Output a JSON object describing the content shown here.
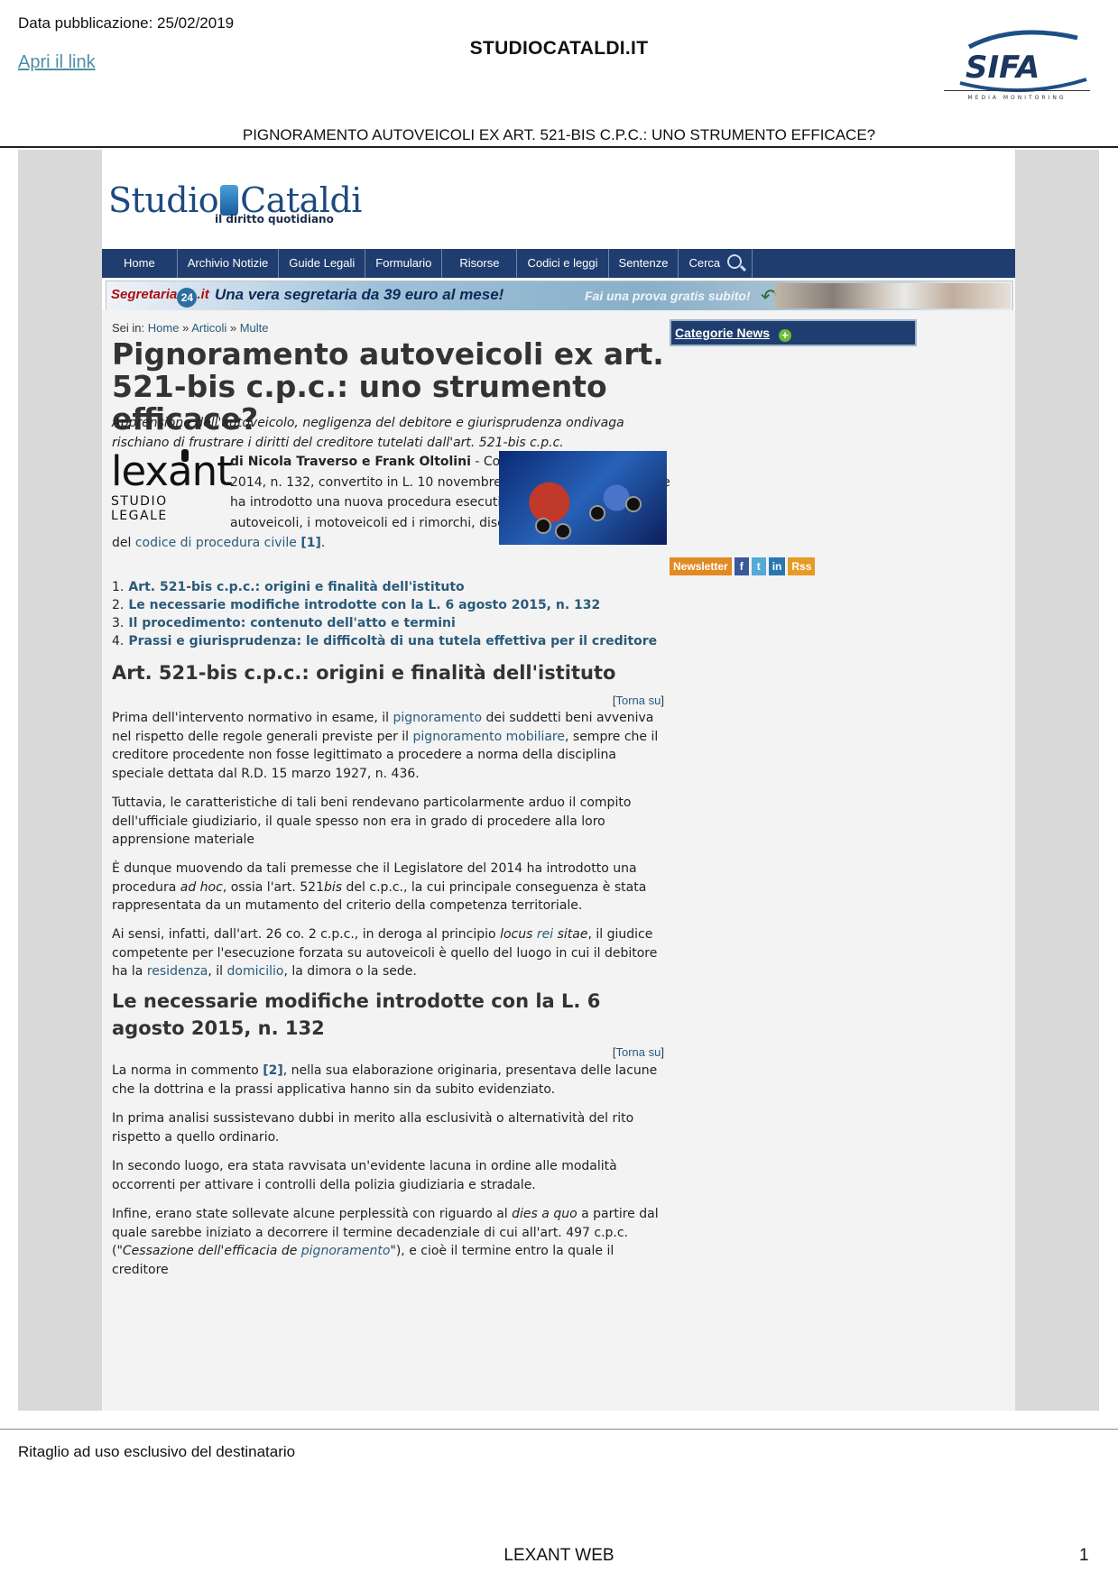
{
  "clipping": {
    "pub_date": "Data pubblicazione: 25/02/2019",
    "open_link": "Apri il link",
    "source": "STUDIOCATALDI.IT",
    "sifa_logo": "SIFA",
    "sifa_sub": "MEDIA MONITORING",
    "title": "PIGNORAMENTO AUTOVEICOLI EX ART. 521-BIS C.P.C.: UNO STRUMENTO EFFICACE?",
    "restricted": "Ritaglio ad uso esclusivo del destinatario",
    "footer_source": "LEXANT WEB",
    "page_number": "1"
  },
  "site": {
    "logo_left": "Studio",
    "logo_right": "Cataldi",
    "logo_sub": "il diritto quotidiano",
    "nav": [
      "Home",
      "Archivio Notizie",
      "Guide Legali",
      "Formulario",
      "Risorse",
      "Codici e leggi",
      "Sentenze",
      "Cerca"
    ],
    "banner": {
      "brand": "Segretaria",
      "brand_num": "24",
      "brand_tld": ".it",
      "message": "Una vera segretaria da 39 euro al mese!",
      "cta": "Fai una prova gratis subito!"
    },
    "breadcrumb": {
      "prefix": "Sei in:",
      "items": [
        "Home",
        "Articoli",
        "Multe"
      ],
      "sep": "»"
    },
    "sidebar": {
      "categories": "Categorie News",
      "social": [
        "Newsletter",
        "f",
        "t",
        "in",
        "Rss"
      ]
    }
  },
  "article": {
    "title": "Pignoramento autoveicoli ex art. 521-bis c.p.c.: uno strumento efficace?",
    "lead": "Apprensione dell'autoveicolo, negligenza del debitore e giurisprudenza ondivaga rischiano di frustrare i diritti del creditore tutelati dall'art. 521-bis c.p.c.",
    "lexant": {
      "word_a": "lex",
      "word_b": "ant",
      "sub": "STUDIO LEGALE"
    },
    "authors": "di Nicola Traverso e Frank Oltolini",
    "intro_1": " - Con il D.L. 12 settembre 2014, n. 132, convertito in L. 10 novembre 2014, n. 162 il Legislatore ha introdotto una nuova procedura esecutiva con riferimento agli autoveicoli, i motoveicoli ed i rimorchi, disciplinata dall'art. 521-bis del ",
    "intro_link": "codice di procedura civile",
    "intro_cite": "[1]",
    "toc": [
      "Art. 521-bis c.p.c.: origini e finalità dell'istituto",
      "Le necessarie modifiche introdotte con la L. 6 agosto 2015, n. 132",
      "Il procedimento: contenuto dell'atto e termini",
      "Prassi e giurisprudenza: le difficoltà di una tutela effettiva per il creditore"
    ],
    "totop": "Torna su",
    "s1": {
      "title": "Art. 521-bis c.p.c.: origini e finalità dell'istituto",
      "p1_a": "Prima dell'intervento normativo in esame, il ",
      "p1_link1": "pignoramento",
      "p1_b": " dei suddetti beni avveniva nel rispetto delle regole generali previste per il ",
      "p1_link2": "pignoramento mobiliare",
      "p1_c": ", sempre che il creditore procedente non fosse legittimato a procedere a norma della disciplina speciale dettata dal R.D. 15 marzo 1927, n. 436.",
      "p2": "Tuttavia, le caratteristiche di tali beni rendevano particolarmente arduo il compito dell'ufficiale giudiziario, il quale spesso non era in grado di procedere alla loro apprensione materiale",
      "p3_a": "È dunque muovendo da tali premesse che il Legislatore del 2014 ha introdotto una procedura ",
      "p3_i1": "ad hoc",
      "p3_b": ", ossia l'art. 521",
      "p3_i2": "bis",
      "p3_c": " del c.p.c., la cui principale conseguenza è stata rappresentata da un mutamento del criterio della competenza territoriale.",
      "p4_a": "Ai sensi, infatti, dall'art. 26 co. 2 c.p.c., in deroga al principio ",
      "p4_i1": "locus",
      "p4_link1": "rei",
      "p4_i2": "sitae",
      "p4_b": ", il giudice competente per l'esecuzione forzata su autoveicoli è quello del luogo in cui il debitore ha la ",
      "p4_link2": "residenza",
      "p4_c": ", il ",
      "p4_link3": "domicilio",
      "p4_d": ", la dimora o la sede."
    },
    "s2": {
      "title": "Le necessarie modifiche introdotte con la L. 6 agosto 2015, n. 132",
      "p1_a": "La norma in commento ",
      "p1_cite": "[2]",
      "p1_b": ", nella sua elaborazione originaria, presentava delle lacune che la dottrina e la prassi applicativa hanno sin da subito evidenziato.",
      "p2": "In prima analisi sussistevano dubbi in merito alla esclusività o alternatività del rito rispetto a quello ordinario.",
      "p3": "In secondo luogo, era stata ravvisata un'evidente lacuna in ordine alle modalità occorrenti per attivare i controlli della polizia giudiziaria e stradale.",
      "p4_a": "Infine, erano state sollevate alcune perplessità con riguardo al ",
      "p4_i1": "dies a quo",
      "p4_b": " a partire dal quale sarebbe iniziato a decorrere il termine decadenziale di cui all'art. 497 c.p.c. (\"",
      "p4_i2": "Cessazione dell'efficacia de ",
      "p4_link": "pignoramento",
      "p4_c": "\"), e cioè il termine entro la quale il creditore"
    }
  }
}
